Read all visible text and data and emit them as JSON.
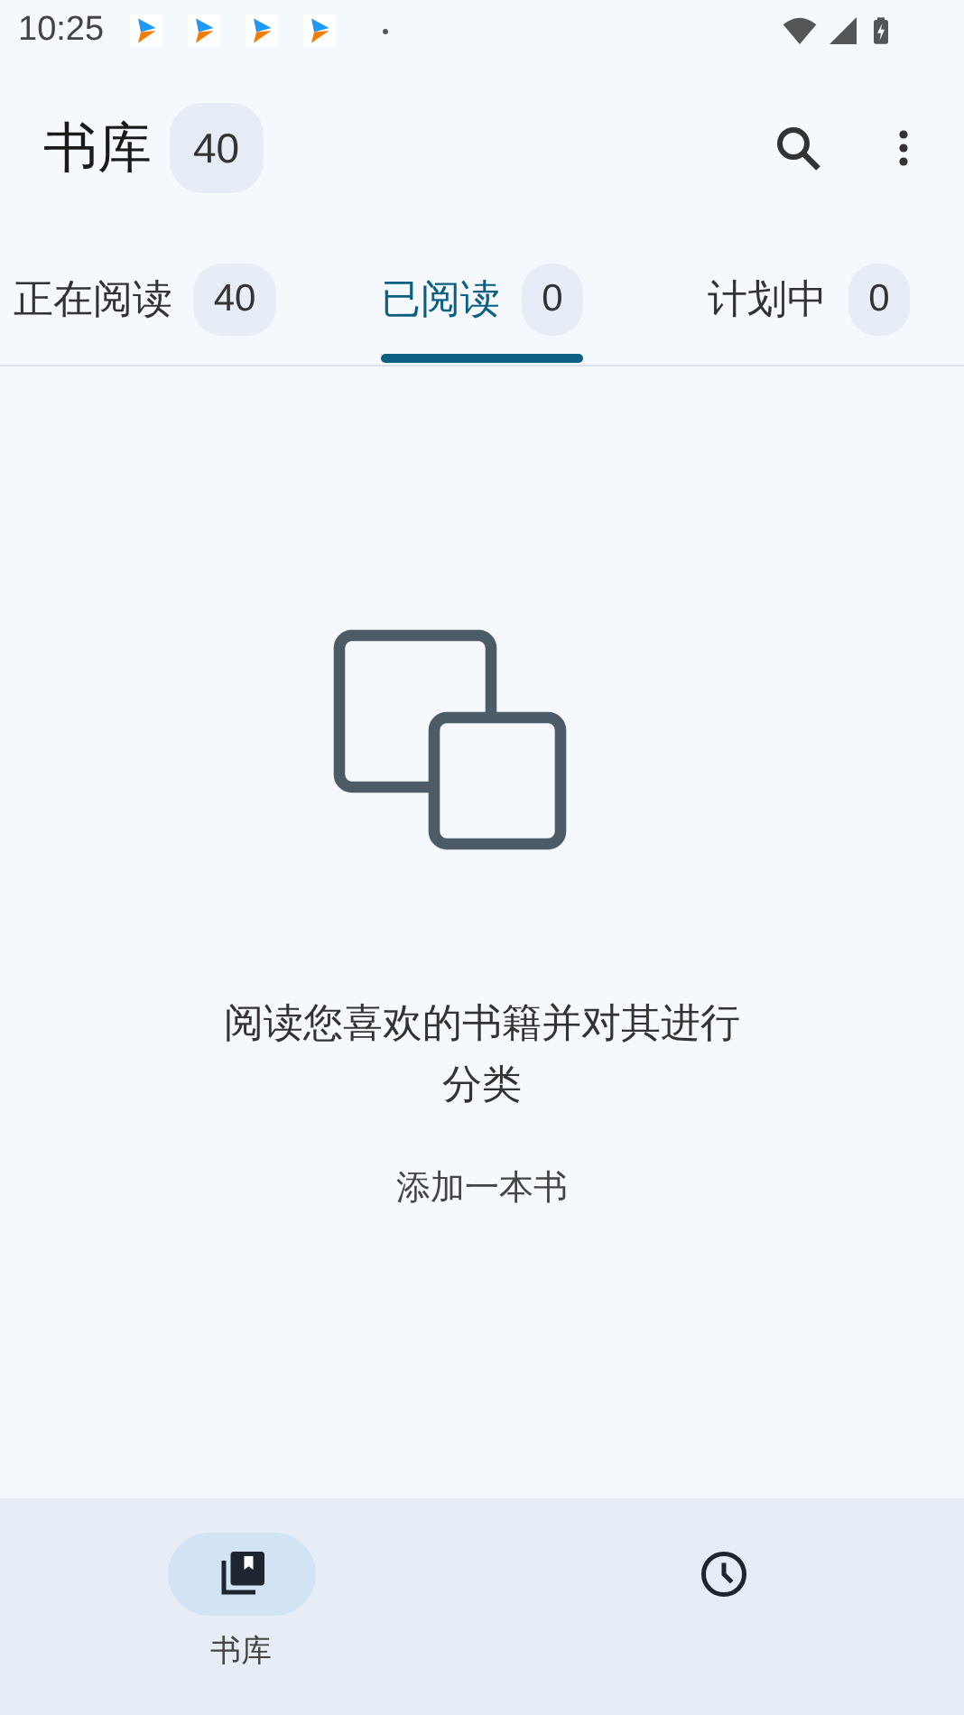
{
  "status_bar": {
    "time": "10:25",
    "notifications": [
      {
        "kind": "app"
      },
      {
        "kind": "app"
      },
      {
        "kind": "app"
      },
      {
        "kind": "app"
      }
    ]
  },
  "app_bar": {
    "title": "书库",
    "count": "40"
  },
  "tabs": [
    {
      "label": "正在阅读",
      "count": "40",
      "selected": false
    },
    {
      "label": "已阅读",
      "count": "0",
      "selected": true
    },
    {
      "label": "计划中",
      "count": "0",
      "selected": false
    }
  ],
  "empty_state": {
    "message": "阅读您喜欢的书籍并对其进行分类",
    "action": "添加一本书"
  },
  "bottom_nav": [
    {
      "kind": "library",
      "label": "书库",
      "selected": true
    },
    {
      "kind": "history",
      "selected": false
    }
  ]
}
